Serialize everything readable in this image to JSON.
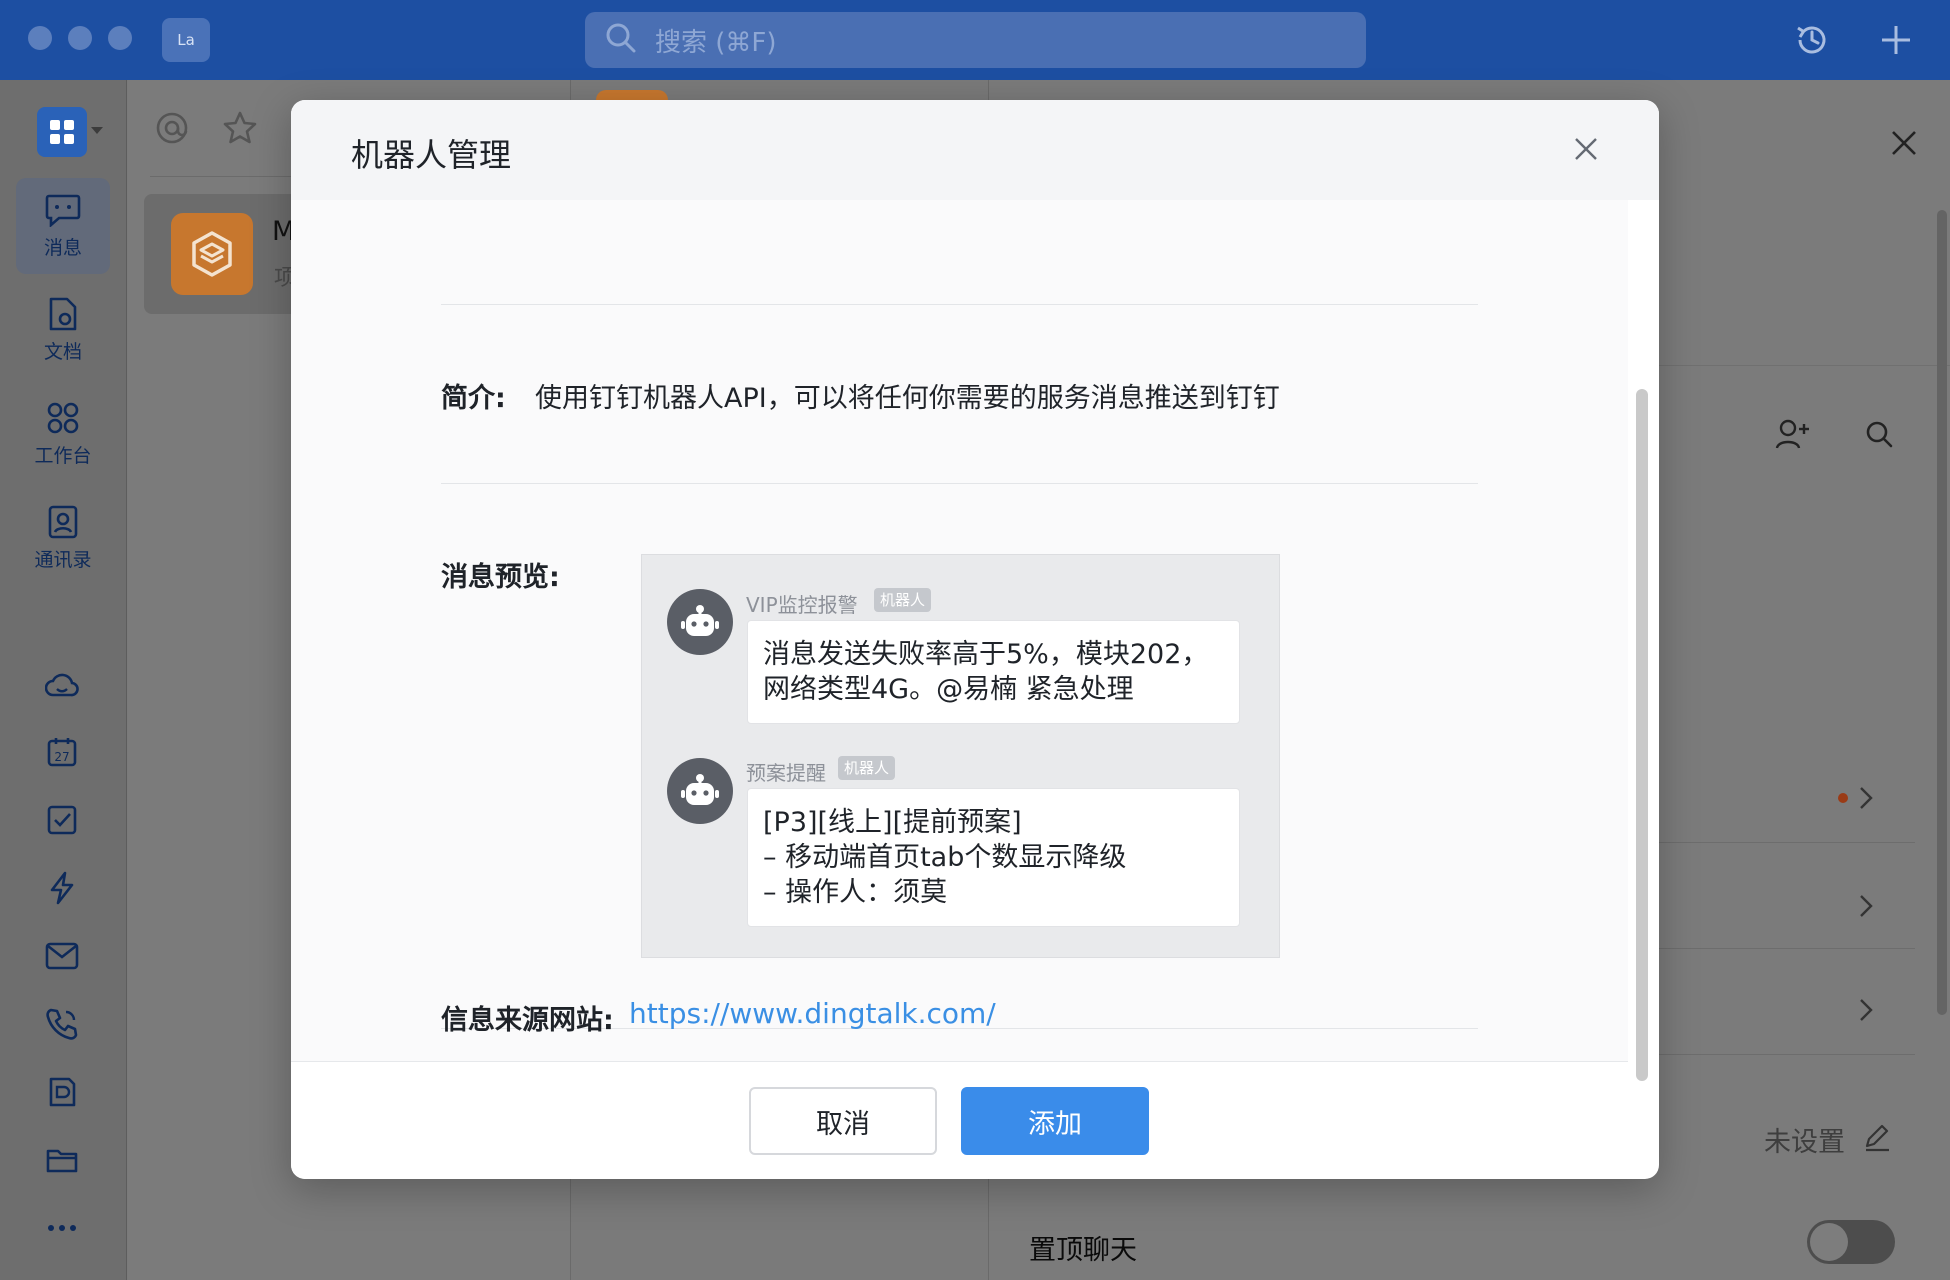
{
  "titlebar": {
    "app_badge": "La",
    "search_placeholder": "搜索 (⌘F)"
  },
  "nav": {
    "items": [
      {
        "label": "消息",
        "icon": "message-icon",
        "active": true
      },
      {
        "label": "文档",
        "icon": "document-icon"
      },
      {
        "label": "工作台",
        "icon": "workbench-icon"
      },
      {
        "label": "通讯录",
        "icon": "contacts-icon"
      }
    ],
    "tools": [
      "cloud-icon",
      "calendar-icon",
      "todo-icon",
      "lightning-icon",
      "mail-icon",
      "phone-icon",
      "notes-icon",
      "folder-icon",
      "more-icon"
    ],
    "calendar_day": "27"
  },
  "chatlist": {
    "item_name": "M",
    "item_sub": "项"
  },
  "rightpanel": {
    "unset_value": "未设置",
    "pin_chat_label": "置顶聊天"
  },
  "modal": {
    "title": "机器人管理",
    "intro_label": "简介:",
    "intro_text": "使用钉钉机器人API，可以将任何你需要的服务消息推送到钉钉",
    "preview_label": "消息预览:",
    "messages": [
      {
        "sender": "VIP监控报警",
        "tag": "机器人",
        "text": "消息发送失败率高于5%，模块202，\n网络类型4G。@易楠 紧急处理"
      },
      {
        "sender": "预案提醒",
        "tag": "机器人",
        "text": "[P3][线上][提前预案]\n– 移动端首页tab个数显示降级\n– 操作人：须莫"
      }
    ],
    "source_label": "信息来源网站:",
    "source_url": "https://www.dingtalk.com/",
    "cancel_label": "取消",
    "add_label": "添加"
  },
  "colors": {
    "titlebar": "#1d4fa2",
    "primary_button": "#3a8cea",
    "link": "#3a8fe4"
  }
}
